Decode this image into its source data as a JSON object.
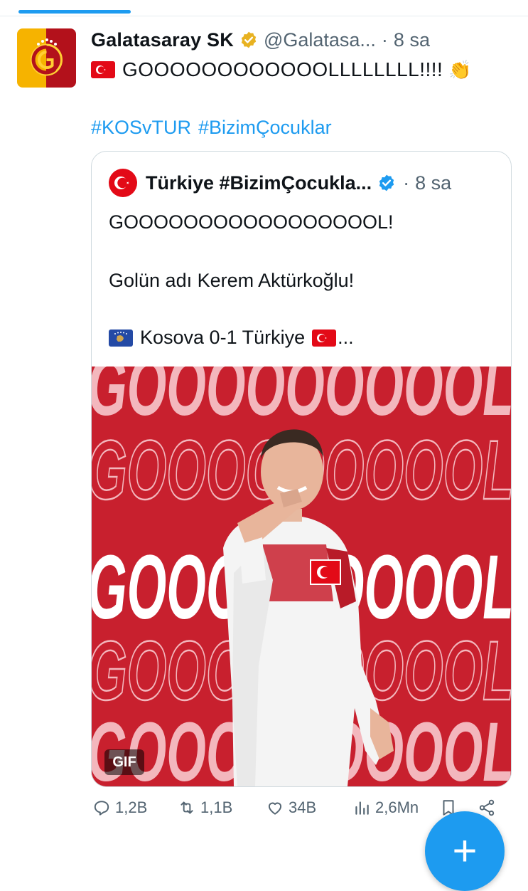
{
  "tweet": {
    "author_name": "Galatasaray SK",
    "handle": "@Galatasa...",
    "separator": "·",
    "time": "8 sa",
    "text": "GOOOOOOOOOOOOLLLLLLLL!!!!",
    "emoji": "👏",
    "hashtags": [
      "#KOSvTUR",
      "#BizimÇocuklar"
    ]
  },
  "quoted": {
    "author_name": "Türkiye #BizimÇocukla...",
    "separator": "·",
    "time": "8 sa",
    "line1": "GOOOOOOOOOOOOOOOOOL!",
    "line2": "Golün adı Kerem Aktürkoğlu!",
    "line3": "Kosova 0-1 Türkiye",
    "line3_suffix": "...",
    "media_words": [
      "GOOOOOOOOOL",
      "GOOOOOOOOOL",
      "GOOOOOOOOOL",
      "GOOOOOOOOOL",
      "GOOOOOOOOOL"
    ],
    "gif_label": "GIF"
  },
  "actions": {
    "replies": "1,2B",
    "retweets": "1,1B",
    "likes": "34B",
    "views": "2,6Mn"
  },
  "fab_label": "+",
  "colors": {
    "accent": "#1d9bf0",
    "media_red": "#c8202e",
    "muted": "#536471"
  }
}
